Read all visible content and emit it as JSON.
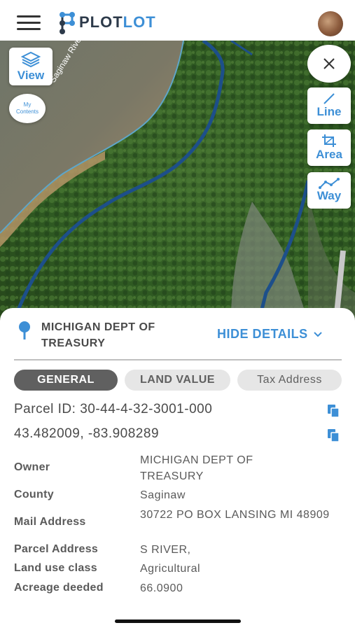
{
  "app": {
    "logo_part1": "PLOT",
    "logo_part2": "LOT"
  },
  "icons": {
    "menu": "hamburger-icon",
    "avatar": "user-avatar",
    "layers": "layers-icon",
    "close": "close-icon",
    "line": "line-tool-icon",
    "area": "crop-area-icon",
    "way": "polyline-icon",
    "pin": "location-pin-icon",
    "chevron": "chevron-down-icon",
    "copy": "copy-icon"
  },
  "colors": {
    "accent": "#3d8fd6",
    "tab_active": "#606060",
    "tab_inactive": "#e6e6e6",
    "text": "#4a4a4a"
  },
  "map": {
    "river_label": "Saginaw River",
    "view_label": "View",
    "my_contents_line1": "My",
    "my_contents_line2": "Contents",
    "tools": {
      "line": "Line",
      "area": "Area",
      "way": "Way"
    }
  },
  "details": {
    "owner_title": "MICHIGAN DEPT OF TREASURY",
    "hide_details": "HIDE DETAILS",
    "tabs": {
      "general": "GENERAL",
      "land_value": "LAND VALUE",
      "tax_address": "Tax Address"
    },
    "parcel_id": "Parcel ID: 30-44-4-32-3001-000",
    "coordinates": "43.482009, -83.908289",
    "rows": [
      {
        "label": "Owner",
        "value": "MICHIGAN DEPT OF TREASURY"
      },
      {
        "label": "County",
        "value": "Saginaw"
      },
      {
        "label": "Mail Address",
        "value": "30722 PO BOX  LANSING MI 48909"
      },
      {
        "label": "Parcel Address",
        "value": "S RIVER,"
      },
      {
        "label": "Land use class",
        "value": "Agricultural"
      },
      {
        "label": "Acreage deeded",
        "value": "66.0900"
      }
    ]
  }
}
